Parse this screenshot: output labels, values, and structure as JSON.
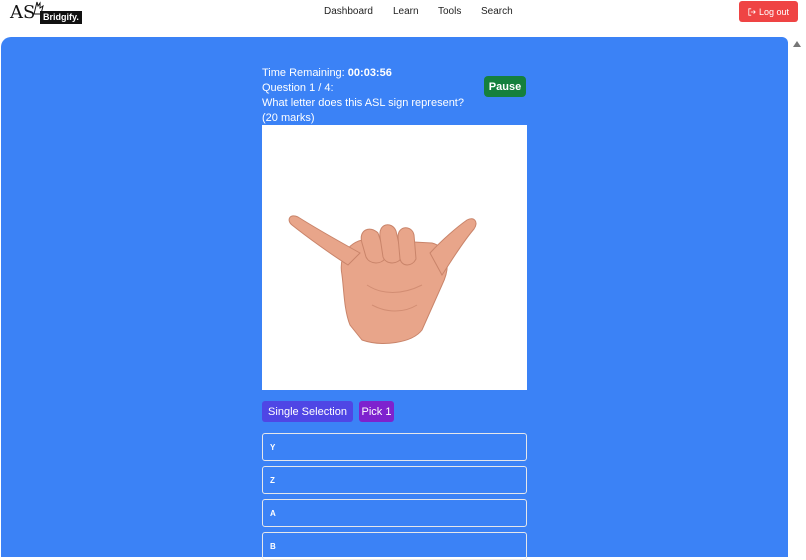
{
  "brand": {
    "logo_text": "AS",
    "logo_badge": "Bridgify."
  },
  "nav": {
    "links": [
      "Dashboard",
      "Learn",
      "Tools",
      "Search"
    ],
    "logout_label": "Log out"
  },
  "quiz": {
    "time_label": "Time Remaining: ",
    "time_value": "00:03:56",
    "question_counter": "Question 1 / 4:",
    "question_text": "What letter does this ASL sign represent?",
    "marks": "(20 marks)",
    "pause_label": "Pause",
    "image_alt": "hand-sign-image",
    "tags": {
      "type": "Single Selection",
      "pick": "Pick 1"
    },
    "options": [
      "Y",
      "Z",
      "A",
      "B"
    ]
  },
  "colors": {
    "panel": "#3b82f6",
    "logout": "#ef4444",
    "pause": "#15803d",
    "tag_single": "#4f46e5",
    "tag_pick": "#7e22ce"
  }
}
